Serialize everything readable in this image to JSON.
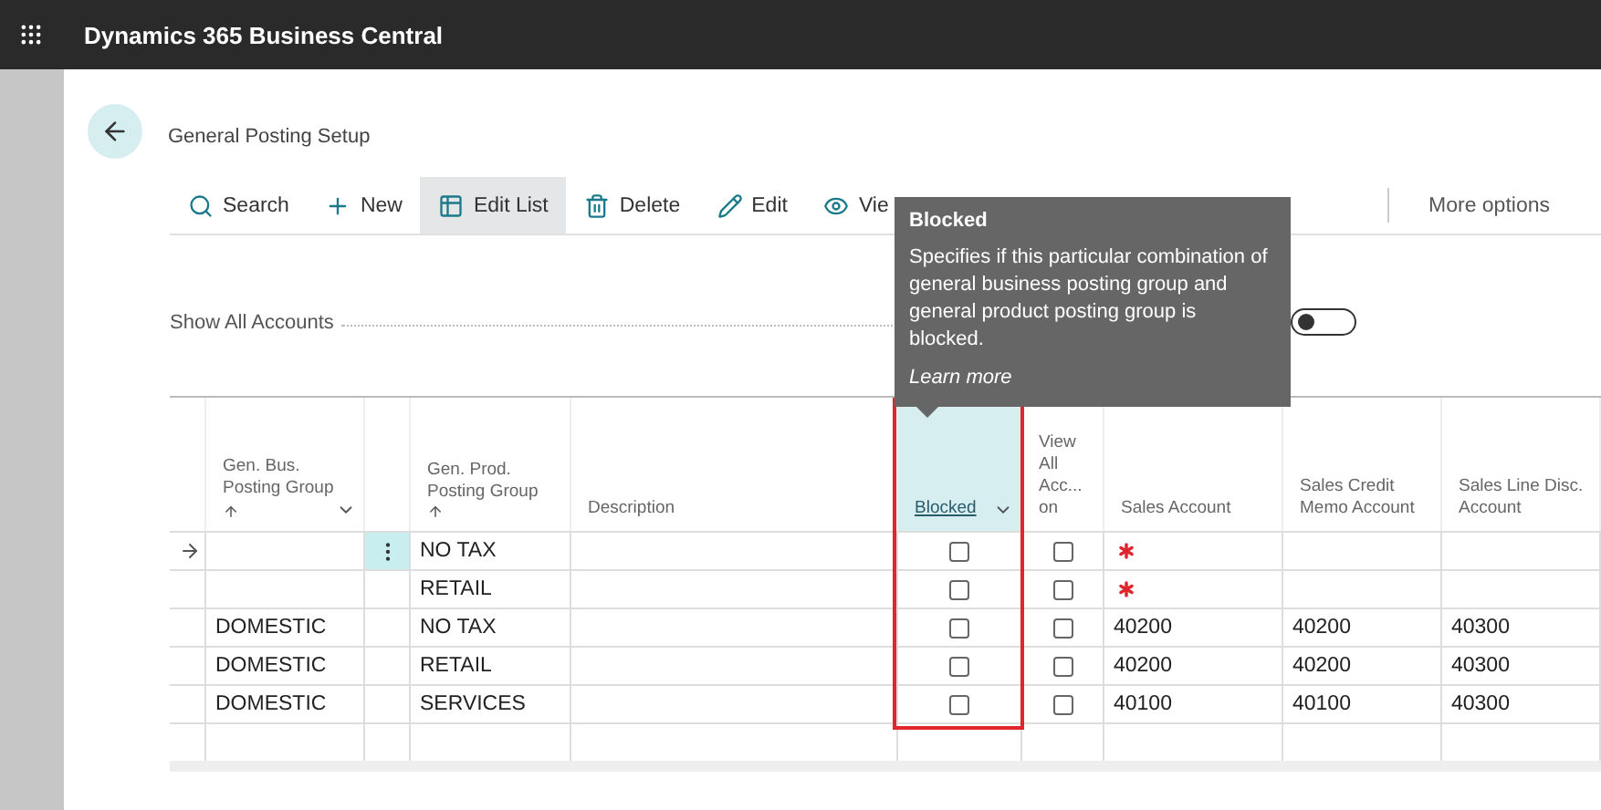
{
  "app_bar": {
    "title": "Dynamics 365 Business Central"
  },
  "page": {
    "title": "General Posting Setup"
  },
  "toolbar": [
    {
      "label": "Search",
      "selected": false
    },
    {
      "label": "New",
      "selected": false
    },
    {
      "label": "Edit List",
      "selected": true
    },
    {
      "label": "Delete",
      "selected": false
    },
    {
      "label": "Edit",
      "selected": false
    },
    {
      "label": "Vie",
      "selected": false
    }
  ],
  "more_options": "More options",
  "show_all_accounts": {
    "label": "Show All Accounts",
    "on": false
  },
  "tooltip": {
    "title": "Blocked",
    "text": "Specifies if this particular combination of general business posting group and general product posting group is blocked.",
    "link": "Learn more"
  },
  "table": {
    "columns": [
      {
        "label": "Gen. Bus. Posting Group",
        "sorted_ascending": true,
        "dropdown": true,
        "selected": false
      },
      {
        "label": "Gen. Prod. Posting Group",
        "sorted_ascending": true,
        "dropdown": false,
        "selected": false
      },
      {
        "label": "Description",
        "sorted_ascending": false,
        "dropdown": false,
        "selected": false
      },
      {
        "label": "Blocked",
        "sorted_ascending": false,
        "dropdown": true,
        "selected": true
      },
      {
        "label": "View All Acc... on",
        "sorted_ascending": false,
        "dropdown": false,
        "selected": false
      },
      {
        "label": "Sales Account",
        "sorted_ascending": false,
        "dropdown": false,
        "selected": false
      },
      {
        "label": "Sales Credit Memo Account",
        "sorted_ascending": false,
        "dropdown": false,
        "selected": false
      },
      {
        "label": "Sales Line Disc. Account",
        "sorted_ascending": false,
        "dropdown": false,
        "selected": false
      }
    ],
    "rows": [
      {
        "current": true,
        "gen_bus": "",
        "gen_prod": "NO TAX",
        "description": "",
        "blocked": false,
        "view_all": false,
        "sales_account": "",
        "sales_account_required": true,
        "credit_memo": "",
        "line_disc": ""
      },
      {
        "current": false,
        "gen_bus": "",
        "gen_prod": "RETAIL",
        "description": "",
        "blocked": false,
        "view_all": false,
        "sales_account": "",
        "sales_account_required": true,
        "credit_memo": "",
        "line_disc": ""
      },
      {
        "current": false,
        "gen_bus": "DOMESTIC",
        "gen_prod": "NO TAX",
        "description": "",
        "blocked": false,
        "view_all": false,
        "sales_account": "40200",
        "sales_account_required": false,
        "credit_memo": "40200",
        "line_disc": "40300"
      },
      {
        "current": false,
        "gen_bus": "DOMESTIC",
        "gen_prod": "RETAIL",
        "description": "",
        "blocked": false,
        "view_all": false,
        "sales_account": "40200",
        "sales_account_required": false,
        "credit_memo": "40200",
        "line_disc": "40300"
      },
      {
        "current": false,
        "gen_bus": "DOMESTIC",
        "gen_prod": "SERVICES",
        "description": "",
        "blocked": false,
        "view_all": false,
        "sales_account": "40100",
        "sales_account_required": false,
        "credit_memo": "40100",
        "line_disc": "40300"
      }
    ]
  }
}
